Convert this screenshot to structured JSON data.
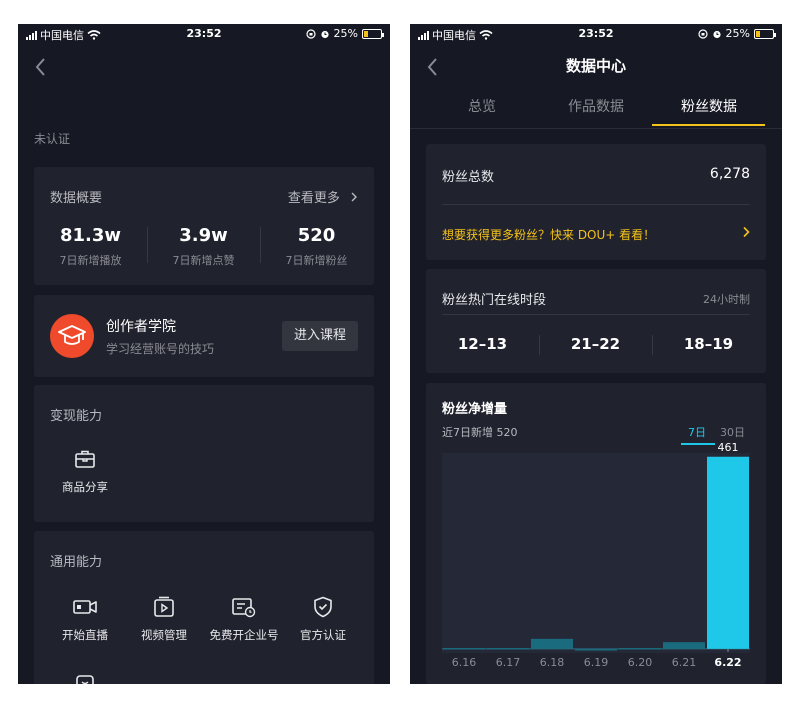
{
  "status_bar": {
    "carrier": "中国电信",
    "time": "23:52",
    "battery": "25%",
    "battery_level": 0.25
  },
  "left": {
    "unverified": "未认证",
    "overview": {
      "title": "数据概要",
      "more": "查看更多",
      "metrics": [
        {
          "value": "81.3w",
          "label": "7日新增播放"
        },
        {
          "value": "3.9w",
          "label": "7日新增点赞"
        },
        {
          "value": "520",
          "label": "7日新增粉丝"
        }
      ]
    },
    "academy": {
      "title": "创作者学院",
      "subtitle": "学习经营账号的技巧",
      "button": "进入课程"
    },
    "monetize": {
      "title": "变现能力",
      "items": [
        {
          "label": "商品分享",
          "icon": "shopping-bag-icon"
        }
      ]
    },
    "general": {
      "title": "通用能力",
      "items": [
        {
          "label": "开始直播",
          "icon": "live-camera-icon"
        },
        {
          "label": "视频管理",
          "icon": "video-manage-icon"
        },
        {
          "label": "免费开企业号",
          "icon": "enterprise-account-icon"
        },
        {
          "label": "官方认证",
          "icon": "verified-shield-icon"
        }
      ]
    }
  },
  "right": {
    "title": "数据中心",
    "tabs": [
      {
        "label": "总览"
      },
      {
        "label": "作品数据"
      },
      {
        "label": "粉丝数据"
      }
    ],
    "active_tab": 2,
    "fans_total": {
      "label": "粉丝总数",
      "value": "6,278",
      "promo": "想要获得更多粉丝？快来 DOU+ 看看！"
    },
    "active_time": {
      "label": "粉丝热门在线时段",
      "hint": "24小时制",
      "slots": [
        "12–13",
        "21–22",
        "18–19"
      ]
    },
    "growth": {
      "title": "粉丝净增量",
      "subtitle": "近7日新增 520",
      "ranges": [
        "7日",
        "30日"
      ],
      "active_range": 0
    }
  },
  "colors": {
    "accent_yellow": "#f4c21b",
    "chart_cyan": "#1fc8e8",
    "bg": "#161823",
    "card": "#20222d",
    "academy_red": "#f04a2c"
  },
  "chart_data": {
    "type": "bar",
    "title": "粉丝净增量",
    "categories": [
      "6.16",
      "6.17",
      "6.18",
      "6.19",
      "6.20",
      "6.21",
      "6.22"
    ],
    "values": [
      2,
      2,
      24,
      -4,
      2,
      16,
      461
    ],
    "highlight_index": 6,
    "data_labels": {
      "6": "461"
    },
    "ylim": [
      -10,
      470
    ]
  }
}
